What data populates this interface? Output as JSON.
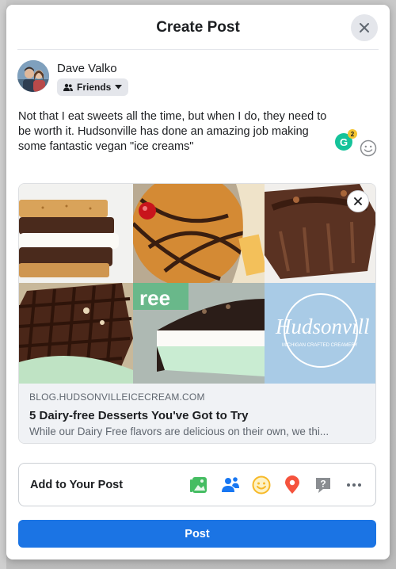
{
  "dialog": {
    "title": "Create Post",
    "close_icon": "close-icon"
  },
  "author": {
    "name": "Dave Valko",
    "audience_label": "Friends",
    "audience_icon": "friends-icon"
  },
  "post": {
    "text": "Not that I eat sweets all the time, but when I do, they need to be worth it. Hudsonville has done an amazing job making some fantastic vegan \"ice creams\"",
    "grammarly_letter": "G",
    "grammarly_count": "2"
  },
  "link_preview": {
    "domain": "BLOG.HUDSONVILLEICECREAM.COM",
    "title": "5 Dairy-free Desserts You've Got to Try",
    "description": "While our Dairy Free flavors are delicious on their own, we thi...",
    "logo_text": "Hudsonvill",
    "logo_subtext": "MICHIGAN CRAFTED CREAMERY",
    "tile_text": "ree"
  },
  "add_to_post": {
    "label": "Add to Your Post",
    "icons": [
      "photo-video-icon",
      "tag-people-icon",
      "feeling-activity-icon",
      "check-in-icon",
      "ask-recommendations-icon",
      "more-icon"
    ]
  },
  "actions": {
    "post_label": "Post"
  },
  "colors": {
    "accent": "#1b74e4",
    "photo_icon": "#45bd62",
    "tag_icon": "#1877f2",
    "feeling_icon": "#f7b928",
    "checkin_icon": "#f5533d",
    "ask_icon": "#8a8d91"
  }
}
